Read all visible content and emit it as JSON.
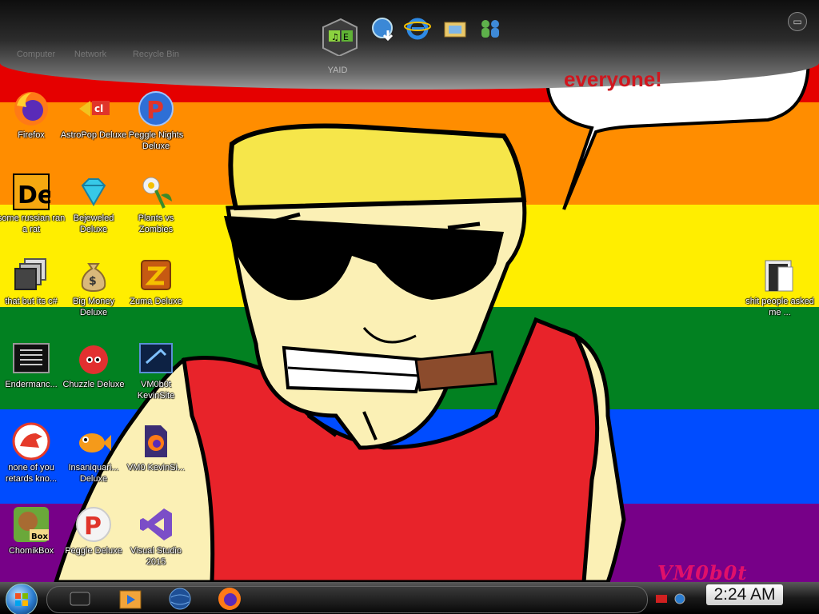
{
  "wallpaper": {
    "stripes": [
      "#e50000",
      "#ff8d00",
      "#ffee00",
      "#028121",
      "#004cff",
      "#770088"
    ],
    "speech_bubble_text": "everyone!",
    "watermark": "VM0b0t"
  },
  "topdock": {
    "items": [
      {
        "name": "yaid",
        "label": "YAID"
      },
      {
        "name": "globe-download"
      },
      {
        "name": "internet-explorer"
      },
      {
        "name": "folder-photo"
      },
      {
        "name": "messenger"
      }
    ],
    "faded_labels": [
      "Computer",
      "Network",
      "Recycle Bin"
    ]
  },
  "desktop_icons": [
    {
      "label": "Firefox"
    },
    {
      "label": "AstroPop Deluxe"
    },
    {
      "label": "Peggle Nights Deluxe"
    },
    {
      "label": "some russian ran a rat"
    },
    {
      "label": "Bejeweled Deluxe"
    },
    {
      "label": "Plants vs Zombies"
    },
    {
      "label": "that but its c#"
    },
    {
      "label": "Big Money Deluxe"
    },
    {
      "label": "Zuma Deluxe"
    },
    {
      "label": "Endermanc..."
    },
    {
      "label": "Chuzzle Deluxe"
    },
    {
      "label": "VM0b0t KevinSite"
    },
    {
      "label": "none of you retards kno..."
    },
    {
      "label": "Insaniquari... Deluxe"
    },
    {
      "label": "VM0 KevinSi..."
    },
    {
      "label": "ChomikBox"
    },
    {
      "label": "Peggle Deluxe"
    },
    {
      "label": "Visual Studio 2015"
    },
    {
      "label": "shit people asked me ..."
    }
  ],
  "taskbar": {
    "pinned": [
      "media-icon",
      "video-player-icon",
      "globe-icon",
      "firefox-icon"
    ],
    "clock": "2:24 AM"
  }
}
